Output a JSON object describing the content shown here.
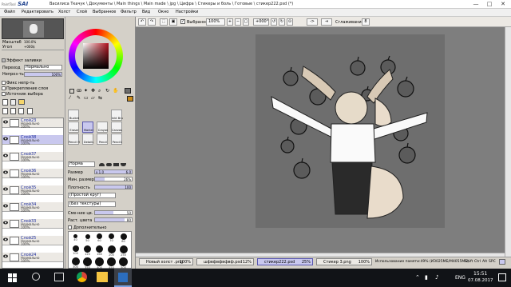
{
  "app": {
    "logo_prefix": "PaintTool",
    "logo_name": "SAI",
    "window_title": "Василиса Ткачук \\ Документы \\ Main things \\ Main made \\ jpg \\ Цифра \\ Стикеры и боль \\ Готовые \\ стикер222.psd (*)",
    "controls": {
      "minimize": "—",
      "maximize": "□",
      "close": "✕"
    }
  },
  "menu": {
    "items": [
      "Файл",
      "Редактировать",
      "Холст",
      "Слой",
      "Выбранное",
      "Фильтр",
      "Вид",
      "Окно",
      "Настройки"
    ]
  },
  "toolbar": {
    "selected_label": "Выбранное",
    "selected_checked": true,
    "zoom": "100%",
    "angle": "+000°",
    "arrow": "->",
    "smoothing_label": "Сглаживание",
    "smoothing_value": "8"
  },
  "navigator": {
    "scale_label": "Масштаб",
    "scale_value": "100.0%",
    "angle_label": "Угол",
    "angle_value": "+000$"
  },
  "layer_props": {
    "effect_label": "Эффект заливки",
    "mode_label": "Переход",
    "mode_value": "Нормально",
    "opacity_label": "Непроз-ть",
    "opacity_value": "100%",
    "clip_label": "Фикс непр-ть",
    "attach_label": "Прикрепление слоя",
    "source_label": "Источник выбора"
  },
  "layers": [
    {
      "name": "Слой23",
      "mode": "Нормально",
      "opacity": "100%",
      "selected": false
    },
    {
      "name": "Слой38",
      "mode": "Нормально",
      "opacity": "100%",
      "selected": true
    },
    {
      "name": "Слой37",
      "mode": "Нормально",
      "opacity": "100%",
      "selected": false
    },
    {
      "name": "Слой36",
      "mode": "Нормально",
      "opacity": "100%",
      "selected": false
    },
    {
      "name": "Слой35",
      "mode": "Нормально",
      "opacity": "100%",
      "selected": false
    },
    {
      "name": "Слой34",
      "mode": "Нормально",
      "opacity": "100%",
      "selected": false
    },
    {
      "name": "Слой33",
      "mode": "Нормально",
      "opacity": "100%",
      "selected": false
    },
    {
      "name": "Слой25",
      "mode": "Нормально",
      "opacity": "100%",
      "selected": false
    },
    {
      "name": "Слой24",
      "mode": "Нормально",
      "opacity": "100%",
      "selected": false
    }
  ],
  "colors": {
    "accent": "#c9c8ee",
    "picker_hue": "#b1101c",
    "primary": "#6d6d6d",
    "secondary": "#c98a1a"
  },
  "tools": [
    {
      "label": "Bucket",
      "selected": false
    },
    {
      "label": "Inkt Brush",
      "selected": false
    },
    {
      "label": "Eraser",
      "selected": false
    },
    {
      "label": "Marker",
      "selected": true
    },
    {
      "label": "Crayon",
      "selected": false
    },
    {
      "label": "Canvas Airbru",
      "selected": false
    },
    {
      "label": "Pencil HB",
      "selected": false
    },
    {
      "label": "Details",
      "selected": false
    },
    {
      "label": "Pencil",
      "selected": false
    },
    {
      "label": "Pencil1",
      "selected": false
    }
  ],
  "brush": {
    "mode_value": "Норма",
    "size_label": "Размер",
    "size_mult": "x 1.0",
    "size_value": "6.0",
    "min_size_label": "Мин. размер",
    "min_size_value": "26%",
    "density_label": "Плотность",
    "density_value": "100",
    "shape_value": "(Простой круг)",
    "texture_value": "(Без текстуры)",
    "blend_label": "Сме-ние цв.",
    "blend_value": "50",
    "dilution_label": "Раст. цвета",
    "dilution_value": "80",
    "extra_label": "Дополнительно",
    "sizes": [
      "40",
      "50",
      "60",
      "70",
      "80",
      "100",
      "120",
      "160",
      "200",
      "250",
      "300",
      "350",
      "400",
      "450",
      "500"
    ]
  },
  "documents": [
    {
      "name": "Новый холст .png",
      "zoom": "100%",
      "active": false
    },
    {
      "name": "шфвфвфвфвф.psd",
      "zoom": "12%",
      "active": false
    },
    {
      "name": "стикер222.psd",
      "zoom": "25%",
      "active": true
    },
    {
      "name": "Стикер 3.png",
      "zoom": "100%",
      "active": false
    }
  ],
  "status": {
    "memory": "Использование памяти:49% (ИЗ025МБ/М4055МБ)",
    "keys": [
      "Shift",
      "Ctrl",
      "Alt",
      "SPC"
    ]
  },
  "taskbar": {
    "lang": "ENG",
    "time": "15:51",
    "date": "07.08.2017"
  }
}
